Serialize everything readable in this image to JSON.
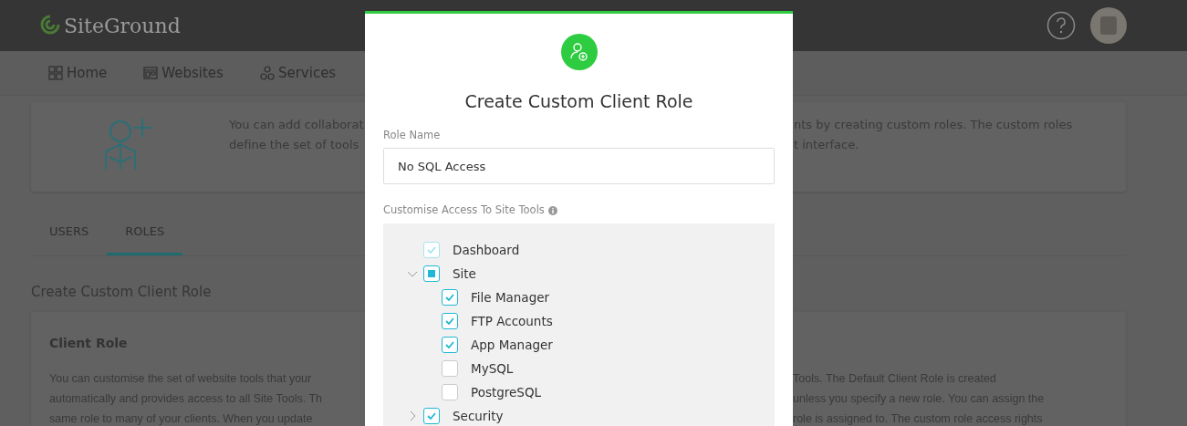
{
  "header": {
    "logo": "SiteGround"
  },
  "nav": [
    {
      "label": "Home"
    },
    {
      "label": "Websites"
    },
    {
      "label": "Services"
    }
  ],
  "intro": {
    "left_lines": [
      "You can add collaborat",
      "define the set of tools"
    ],
    "right_lines": [
      "nts by creating custom roles. The custom roles",
      "t interface."
    ]
  },
  "tabs": [
    {
      "label": "USERS",
      "selected": false
    },
    {
      "label": "ROLES",
      "selected": true
    }
  ],
  "section_title": "Create Custom Client Role",
  "client_role": {
    "title": "Client Role",
    "left_lines": [
      "You can customise the set of website tools that your",
      "automatically and provides access to all Site Tools. Th",
      "same role to many of your clients. When you update"
    ],
    "right_lines": [
      "Tools. The Default Client Role is created",
      "unless you specify a new role. You can assign the",
      "role is assigned to. The custom role access rights"
    ]
  },
  "modal": {
    "title": "Create Custom Client Role",
    "role_name_label": "Role Name",
    "role_name_value": "No SQL Access",
    "access_label": "Customise Access To Site Tools",
    "tree": [
      {
        "label": "Dashboard",
        "checked": true,
        "disabled": true
      },
      {
        "label": "Site",
        "indeterminate": true,
        "expanded": true,
        "children": [
          {
            "label": "File Manager",
            "checked": true
          },
          {
            "label": "FTP Accounts",
            "checked": true
          },
          {
            "label": "App Manager",
            "checked": true
          },
          {
            "label": "MySQL",
            "checked": false
          },
          {
            "label": "PostgreSQL",
            "checked": false
          }
        ]
      },
      {
        "label": "Security",
        "checked": true,
        "expanded": false
      }
    ]
  }
}
